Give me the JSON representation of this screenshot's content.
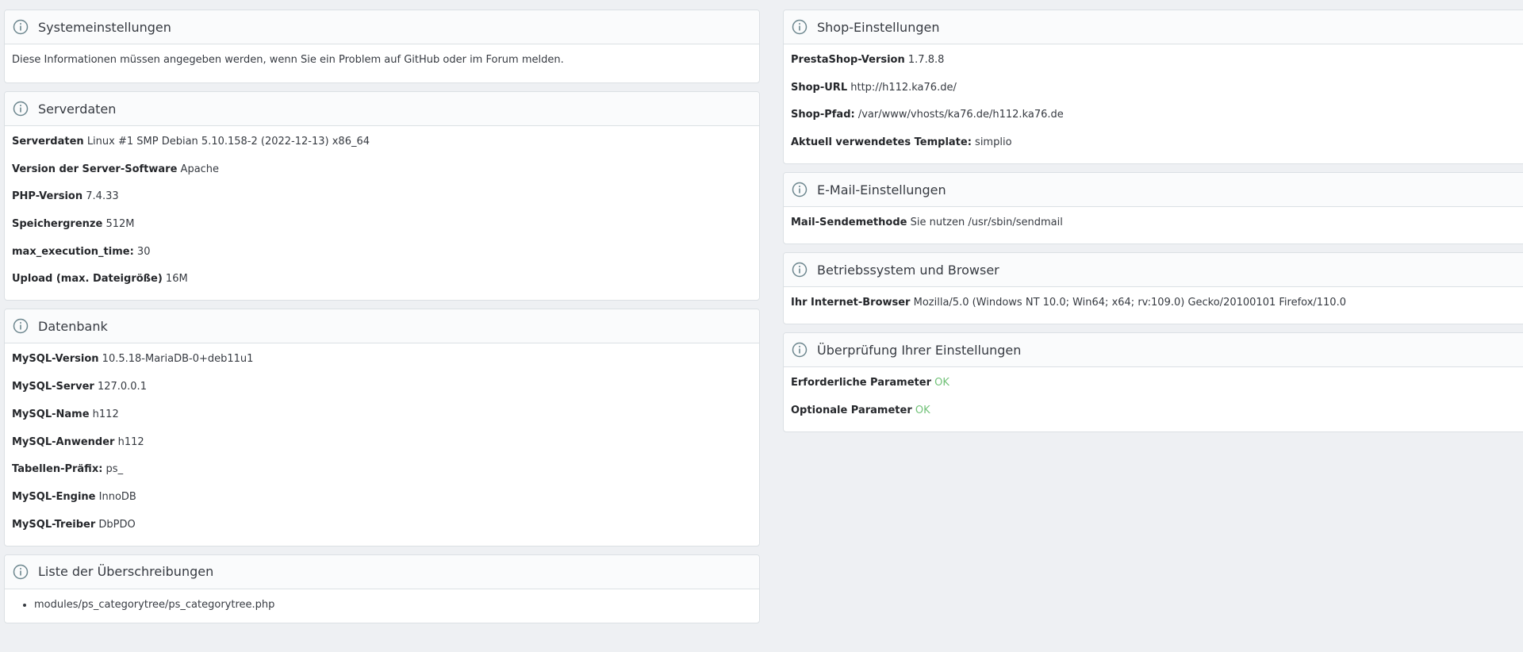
{
  "left": {
    "system": {
      "title": "Systemeinstellungen",
      "description": "Diese Informationen müssen angegeben werden, wenn Sie ein Problem auf GitHub oder im Forum melden."
    },
    "server": {
      "title": "Serverdaten",
      "rows": [
        {
          "label": "Serverdaten",
          "value": "Linux #1 SMP Debian 5.10.158-2 (2022-12-13) x86_64"
        },
        {
          "label": "Version der Server-Software",
          "value": "Apache"
        },
        {
          "label": "PHP-Version",
          "value": "7.4.33"
        },
        {
          "label": "Speichergrenze",
          "value": "512M"
        },
        {
          "label": "max_execution_time:",
          "value": "30"
        },
        {
          "label": "Upload (max. Dateigröße)",
          "value": "16M"
        }
      ]
    },
    "database": {
      "title": "Datenbank",
      "rows": [
        {
          "label": "MySQL-Version",
          "value": "10.5.18-MariaDB-0+deb11u1"
        },
        {
          "label": "MySQL-Server",
          "value": "127.0.0.1"
        },
        {
          "label": "MySQL-Name",
          "value": "h112"
        },
        {
          "label": "MySQL-Anwender",
          "value": "h112"
        },
        {
          "label": "Tabellen-Präfix:",
          "value": "ps_"
        },
        {
          "label": "MySQL-Engine",
          "value": "InnoDB"
        },
        {
          "label": "MySQL-Treiber",
          "value": "DbPDO"
        }
      ]
    },
    "overrides": {
      "title": "Liste der Überschreibungen",
      "items": [
        "modules/ps_categorytree/ps_categorytree.php"
      ]
    }
  },
  "right": {
    "shop": {
      "title": "Shop-Einstellungen",
      "rows": [
        {
          "label": "PrestaShop-Version",
          "value": "1.7.8.8"
        },
        {
          "label": "Shop-URL",
          "value": "http://h112.ka76.de/"
        },
        {
          "label": "Shop-Pfad:",
          "value": "/var/www/vhosts/ka76.de/h112.ka76.de"
        },
        {
          "label": "Aktuell verwendetes Template:",
          "value": "simplio"
        }
      ]
    },
    "mail": {
      "title": "E-Mail-Einstellungen",
      "rows": [
        {
          "label": "Mail-Sendemethode",
          "value": "Sie nutzen /usr/sbin/sendmail"
        }
      ]
    },
    "os": {
      "title": "Betriebssystem und Browser",
      "rows": [
        {
          "label": "Ihr Internet-Browser",
          "value": "Mozilla/5.0 (Windows NT 10.0; Win64; x64; rv:109.0) Gecko/20100101 Firefox/110.0"
        }
      ]
    },
    "check": {
      "title": "Überprüfung Ihrer Einstellungen",
      "rows": [
        {
          "label": "Erforderliche Parameter",
          "value": "OK"
        },
        {
          "label": "Optionale Parameter",
          "value": "OK"
        }
      ]
    }
  },
  "icons": {
    "panel_icon": "info-icon"
  },
  "colors": {
    "ok": "#72c279",
    "background": "#eef0f3",
    "panel_border": "#dbe0e4"
  }
}
